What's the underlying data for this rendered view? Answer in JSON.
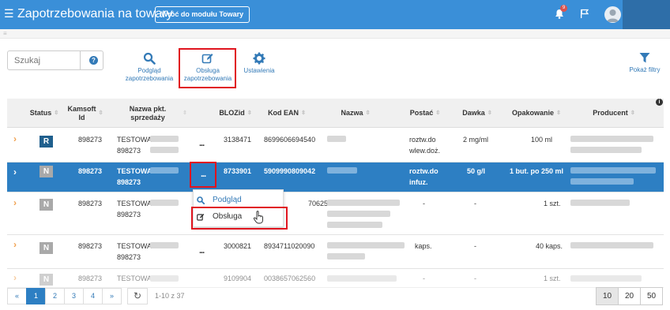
{
  "header": {
    "app_title": "Zapotrzebowania na towary",
    "back_button": "Wróć do modułu Towary",
    "notification_count": "9",
    "accent_color": "#3a8fd8"
  },
  "toolbar": {
    "search_placeholder": "Szukaj",
    "help_label": "?",
    "preview_label_1": "Podgląd",
    "preview_label_2": "zapotrzebowania",
    "handle_label_1": "Obsługa",
    "handle_label_2": "zapotrzebowania",
    "settings_label": "Ustawienia",
    "filters_label": "Pokaż filtry"
  },
  "table": {
    "columns": {
      "status": "Status",
      "kamsoft_1": "Kamsoft",
      "kamsoft_2": "Id",
      "pkt_1": "Nazwa pkt.",
      "pkt_2": "sprzedaży",
      "blozid": "BLOZid",
      "ean": "Kod EAN",
      "nazwa": "Nazwa",
      "postac": "Postać",
      "dawka": "Dawka",
      "opakowanie": "Opakowanie",
      "producent": "Producent"
    },
    "rows": [
      {
        "status": "R",
        "kamsoft": "898273",
        "pkt_1": "TESTOWA",
        "pkt_2": "898273",
        "more": "...",
        "bloz": "3138471",
        "ean": "8699606694540",
        "postac_1": "roztw.do",
        "postac_2": "wlew.doż.",
        "dawka": "2 mg/ml",
        "opakowanie": "100 ml"
      },
      {
        "status": "N",
        "kamsoft": "898273",
        "pkt_1": "TESTOWA",
        "pkt_2": "898273",
        "more": "...",
        "bloz": "8733901",
        "ean": "5909990809042",
        "postac_1": "roztw.do",
        "postac_2": "infuz.",
        "dawka": "50 g/l",
        "opakowanie": "1 but. po 250 ml"
      },
      {
        "status": "N",
        "kamsoft": "898273",
        "pkt_1": "TESTOWA",
        "pkt_2": "898273",
        "more": "",
        "bloz": "",
        "ean": "7062560",
        "postac_1": "-",
        "postac_2": "",
        "dawka": "-",
        "opakowanie": "1 szt."
      },
      {
        "status": "N",
        "kamsoft": "898273",
        "pkt_1": "TESTOWA",
        "pkt_2": "898273",
        "more": "...",
        "bloz": "3000821",
        "ean": "8934711020090",
        "postac_1": "kaps.",
        "postac_2": "",
        "dawka": "-",
        "opakowanie": "40 kaps."
      },
      {
        "status": "N",
        "kamsoft": "898273",
        "pkt_1": "TESTOWA",
        "pkt_2": "898273",
        "more": "",
        "bloz": "9109904",
        "ean": "0038657062560",
        "postac_1": "-",
        "postac_2": "",
        "dawka": "-",
        "opakowanie": "1 szt."
      }
    ]
  },
  "row_menu": {
    "preview": "Podgląd",
    "handle": "Obsługa"
  },
  "pagination": {
    "first": "«",
    "pages": [
      "1",
      "2",
      "3",
      "4"
    ],
    "next": "»",
    "range": "1-10 z 37",
    "sizes": [
      "10",
      "20",
      "50"
    ]
  },
  "colors": {
    "selected_row": "#2d7fc3",
    "highlight": "#e0141e",
    "status_r": "#1f5f8d",
    "status_n": "#a9a9a9"
  }
}
